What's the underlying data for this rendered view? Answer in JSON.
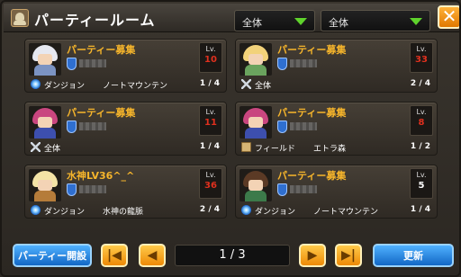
{
  "window": {
    "title": "パーティールーム",
    "close_label": "✕"
  },
  "filters": {
    "filter1": "全体",
    "filter2": "全体"
  },
  "rooms": [
    {
      "title": "パーティー募集",
      "lv": "10",
      "lv_color": "#e0301e",
      "kind": "ダンジョン",
      "area": "ノートマウンテン",
      "count": "1 / 4",
      "icon": "portal",
      "hair": "#e6e8f0",
      "body": "#7b93c2"
    },
    {
      "title": "パーティー募集",
      "lv": "33",
      "lv_color": "#e0301e",
      "kind": "全体",
      "area": "",
      "count": "2 / 4",
      "icon": "sword",
      "hair": "#f2d27a",
      "body": "#6aa35e"
    },
    {
      "title": "パーティー募集",
      "lv": "11",
      "lv_color": "#e0301e",
      "kind": "全体",
      "area": "",
      "count": "1 / 4",
      "icon": "sword",
      "hair": "#c9467f",
      "body": "#3d4fae"
    },
    {
      "title": "パーティー募集",
      "lv": "8",
      "lv_color": "#e0301e",
      "kind": "フィールド",
      "area": "エトラ森",
      "count": "1 / 2",
      "icon": "map",
      "hair": "#c9467f",
      "body": "#3d4fae"
    },
    {
      "title": "水神LV36^_^",
      "lv": "36",
      "lv_color": "#e0301e",
      "kind": "ダンジョン",
      "area": "水神の龍脈",
      "count": "2 / 4",
      "icon": "portal",
      "hair": "#f3e3a6",
      "body": "#b57c3a"
    },
    {
      "title": "パーティー募集",
      "lv": "5",
      "lv_color": "#ffffff",
      "kind": "ダンジョン",
      "area": "ノートマウンテン",
      "count": "1 / 4",
      "icon": "portal",
      "hair": "#5b3a25",
      "body": "#3c7a4a"
    }
  ],
  "lv_label": "Lv.",
  "bottom": {
    "create_label": "パーティー開設",
    "first_label": "|◀",
    "prev_label": "◀",
    "page_text": "1 / 3",
    "next_label": "▶",
    "last_label": "▶|",
    "refresh_label": "更新"
  }
}
